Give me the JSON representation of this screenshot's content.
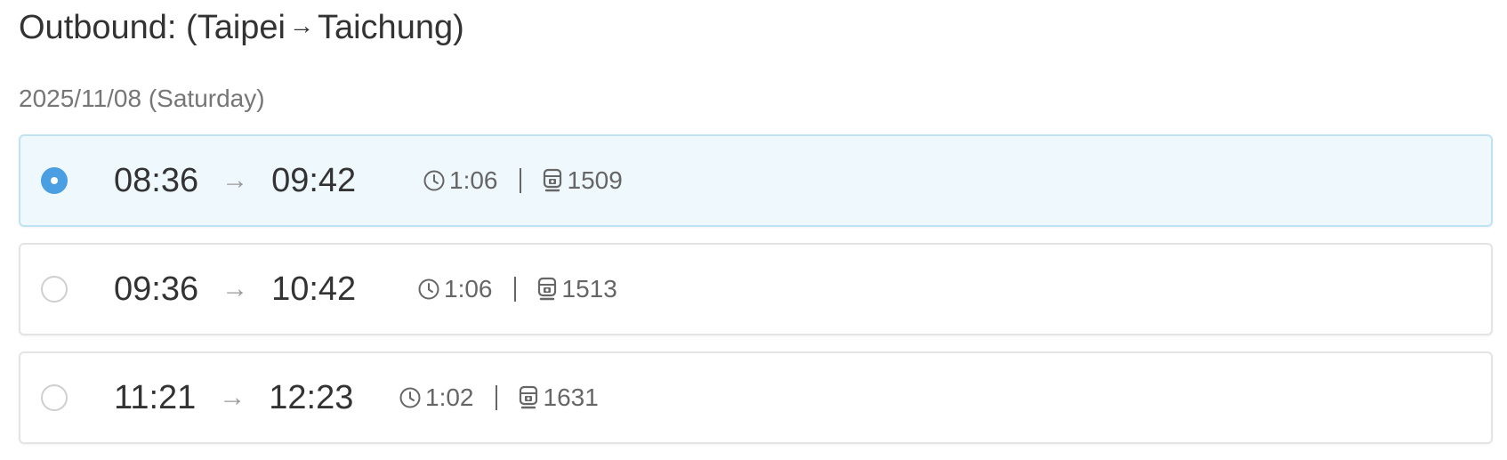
{
  "header": {
    "title_prefix": "Outbound: (Taipei",
    "title_arrow": "→",
    "title_suffix": "Taichung)"
  },
  "date_label": "2025/11/08 (Saturday)",
  "trips": [
    {
      "depart": "08:36",
      "arrow": "→",
      "arrive": "09:42",
      "duration": "1:06",
      "train_no": "1509",
      "selected": true
    },
    {
      "depart": "09:36",
      "arrow": "→",
      "arrive": "10:42",
      "duration": "1:06",
      "train_no": "1513",
      "selected": false
    },
    {
      "depart": "11:21",
      "arrow": "→",
      "arrive": "12:23",
      "duration": "1:02",
      "train_no": "1631",
      "selected": false
    }
  ],
  "icons": {
    "duration": "clock-icon",
    "train": "train-icon",
    "arrow": "arrow-right-icon"
  },
  "colors": {
    "accent": "#4a9ee2",
    "selected_bg": "#eff8fc",
    "selected_border": "#bfe3f4",
    "card_border": "#e4e4e4",
    "text_primary": "#333333",
    "text_secondary": "#666666",
    "text_muted": "#767676"
  }
}
